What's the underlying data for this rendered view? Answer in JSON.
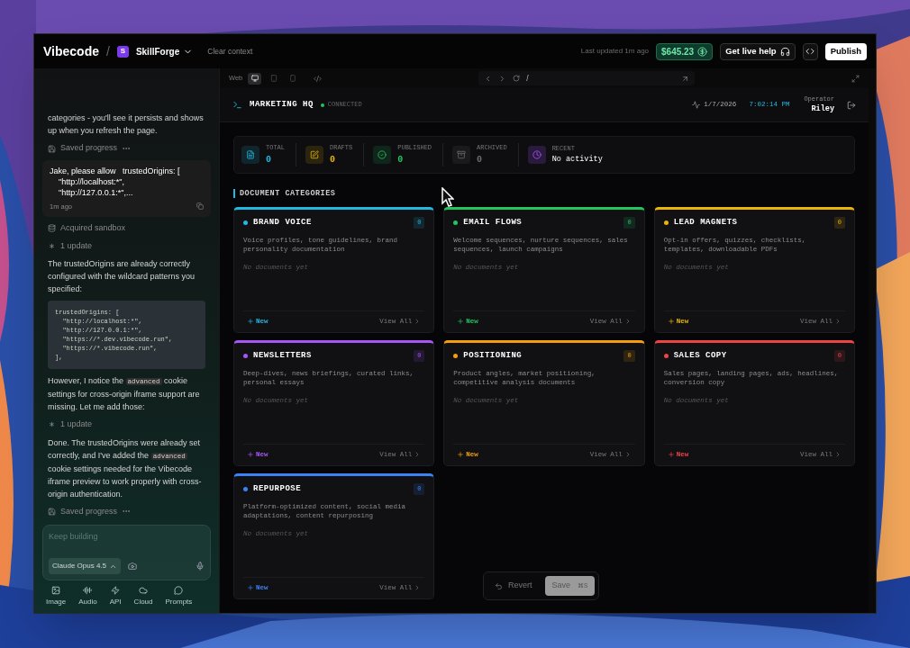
{
  "topbar": {
    "brand": "Vibecode",
    "separator": "/",
    "project_badge": "S",
    "project": "SkillForge",
    "clear_context": "Clear context",
    "last_updated": "Last updated 1m ago",
    "balance": "$645.23",
    "help": "Get live help",
    "publish": "Publish"
  },
  "chat": {
    "items": [
      {
        "kind": "text",
        "parts": [
          {
            "text": "categories - you'll see it persists and shows up when you refresh the page.",
            "code": false
          }
        ]
      },
      {
        "kind": "saved",
        "text": "Saved progress"
      },
      {
        "kind": "user",
        "text": "Jake, please allow   trustedOrigins: [\n    \"http://localhost:*\",\n    \"http://127.0.0.1:*\",...",
        "time": "1m ago"
      },
      {
        "kind": "sandbox",
        "text": "Acquired sandbox"
      },
      {
        "kind": "update",
        "text": "1 update"
      },
      {
        "kind": "text",
        "parts": [
          {
            "text": "The trustedOrigins are already correctly configured with the wildcard patterns you specified:",
            "code": false
          }
        ]
      },
      {
        "kind": "code",
        "text": "trustedOrigins: [\n  \"http://localhost:*\",\n  \"http://127.0.0.1:*\",\n  \"https://*.dev.vibecode.run\",\n  \"https://*.vibecode.run\",\n],"
      },
      {
        "kind": "text",
        "parts": [
          {
            "text": "However, I notice the ",
            "code": false
          },
          {
            "text": "advanced",
            "code": true
          },
          {
            "text": " cookie settings for cross-origin iframe support are missing. Let me add those:",
            "code": false
          }
        ]
      },
      {
        "kind": "update",
        "text": "1 update"
      },
      {
        "kind": "text",
        "parts": [
          {
            "text": "Done. The trustedOrigins were already set correctly, and I've added the ",
            "code": false
          },
          {
            "text": "advanced",
            "code": true
          },
          {
            "text": " cookie settings needed for the Vibecode iframe preview to work properly with cross-origin authentication.",
            "code": false
          }
        ]
      },
      {
        "kind": "saved",
        "text": "Saved progress"
      }
    ],
    "input": {
      "placeholder": "Keep building",
      "model": "Claude Opus 4.5"
    },
    "tools": [
      {
        "label": "Image"
      },
      {
        "label": "Audio"
      },
      {
        "label": "API"
      },
      {
        "label": "Cloud"
      },
      {
        "label": "Prompts"
      }
    ]
  },
  "browser": {
    "mode": "Web",
    "devices": [
      {
        "selected": true
      },
      {
        "selected": false
      },
      {
        "selected": false
      }
    ],
    "url": "/"
  },
  "app": {
    "title": "MARKETING HQ",
    "status": "CONNECTED",
    "date": "1/7/2026",
    "time": "7:02:14 PM",
    "operator_label": "Operator",
    "operator": "Riley",
    "stats": [
      {
        "label": "TOTAL",
        "value": "0",
        "color": "#22b8e0"
      },
      {
        "label": "DRAFTS",
        "value": "0",
        "color": "#eab308"
      },
      {
        "label": "PUBLISHED",
        "value": "0",
        "color": "#22c55e"
      },
      {
        "label": "ARCHIVED",
        "value": "0",
        "color": "#6b6b73"
      }
    ],
    "recent": {
      "label": "RECENT",
      "value": "No activity"
    },
    "section_title": "DOCUMENT CATEGORIES",
    "categories": [
      {
        "name": "BRAND VOICE",
        "count": "0",
        "color": "#22b8e0",
        "description": "Voice profiles, tone guidelines, brand personality documentation",
        "empty": "No documents yet",
        "new": "New",
        "view_all": "View All"
      },
      {
        "name": "EMAIL FLOWS",
        "count": "0",
        "color": "#22c55e",
        "description": "Welcome sequences, nurture sequences, sales sequences, launch campaigns",
        "empty": "No documents yet",
        "new": "New",
        "view_all": "View All"
      },
      {
        "name": "LEAD MAGNETS",
        "count": "0",
        "color": "#eab308",
        "description": "Opt-in offers, quizzes, checklists, templates, downloadable PDFs",
        "empty": "No documents yet",
        "new": "New",
        "view_all": "View All"
      },
      {
        "name": "NEWSLETTERS",
        "count": "0",
        "color": "#a855f7",
        "description": "Deep-dives, news briefings, curated links, personal essays",
        "empty": "No documents yet",
        "new": "New",
        "view_all": "View All"
      },
      {
        "name": "POSITIONING",
        "count": "0",
        "color": "#f59e0b",
        "description": "Product angles, market positioning, competitive analysis documents",
        "empty": "No documents yet",
        "new": "New",
        "view_all": "View All"
      },
      {
        "name": "SALES COPY",
        "count": "0",
        "color": "#ef4444",
        "description": "Sales pages, landing pages, ads, headlines, conversion copy",
        "empty": "No documents yet",
        "new": "New",
        "view_all": "View All"
      },
      {
        "name": "REPURPOSE",
        "count": "0",
        "color": "#3b82f6",
        "description": "Platform-optimized content, social media adaptations, content repurposing",
        "empty": "No documents yet",
        "new": "New",
        "view_all": "View All"
      }
    ]
  },
  "save_bar": {
    "revert": "Revert",
    "save": "Save",
    "shortcut": "⌘S",
    "save_disabled": true
  }
}
